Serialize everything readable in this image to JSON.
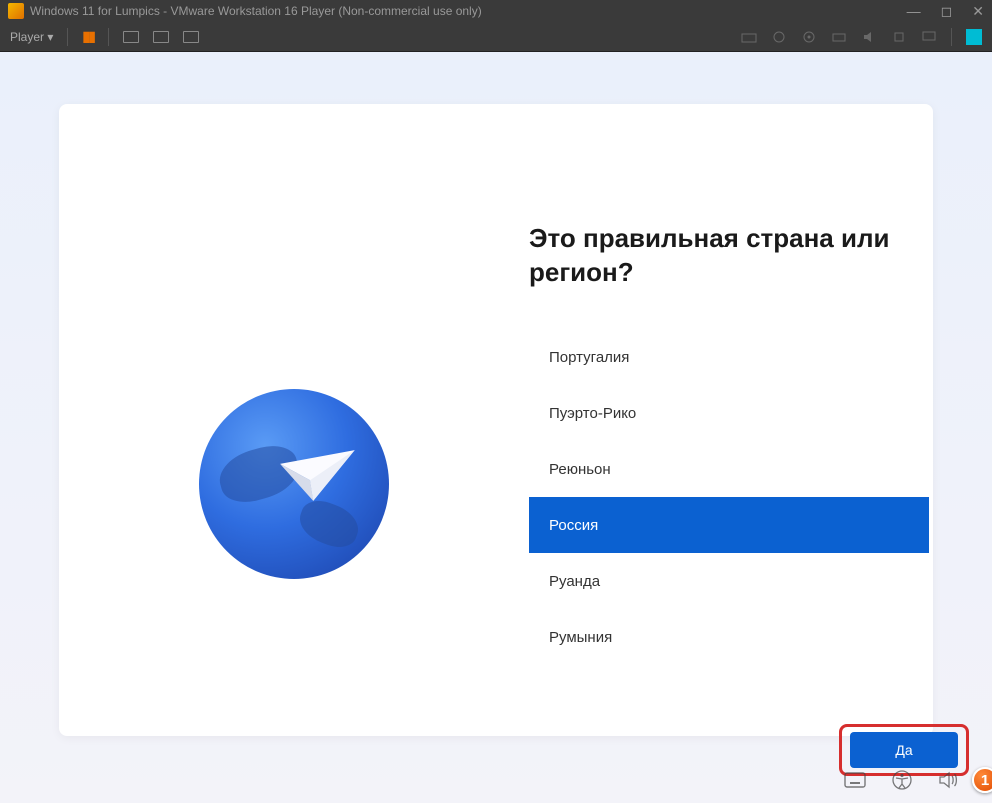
{
  "vmware": {
    "title": "Windows 11 for Lumpics - VMware Workstation 16 Player (Non-commercial use only)",
    "player_label": "Player ▾"
  },
  "oobe": {
    "question": "Это правильная страна или регион?",
    "items": [
      {
        "label": "Португалия",
        "selected": false
      },
      {
        "label": "Пуэрто-Рико",
        "selected": false
      },
      {
        "label": "Реюньон",
        "selected": false
      },
      {
        "label": "Россия",
        "selected": true
      },
      {
        "label": "Руанда",
        "selected": false
      },
      {
        "label": "Румыния",
        "selected": false
      }
    ],
    "confirm_label": "Да"
  },
  "annotation": {
    "badge": "1"
  }
}
